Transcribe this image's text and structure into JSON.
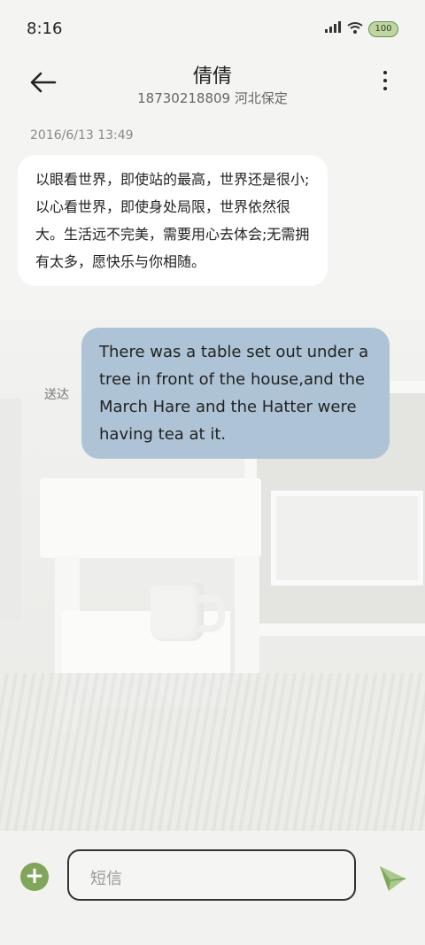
{
  "status_bar": {
    "time": "8:16",
    "signal_text": "000",
    "battery": "100"
  },
  "header": {
    "contact_name": "倩倩",
    "contact_detail": "18730218809 河北保定"
  },
  "conversation": {
    "date": "2016/6/13 13:49",
    "incoming_text": "以眼看世界，即使站的最高，世界还是很小;以心看世界，即使身处局限，世界依然很大。生活远不完美，需要用心去体会;无需拥有太多，愿快乐与你相随。",
    "outgoing_text": "There was a table set out under a tree in front of the house,and the March Hare and the Hatter were having tea at it.",
    "outgoing_status": "送达"
  },
  "composer": {
    "placeholder": "短信"
  },
  "icons": {
    "back": "arrow-left-icon",
    "menu": "more-vertical-icon",
    "add": "plus-circle-icon",
    "send": "paper-plane-icon",
    "wifi": "wifi-icon",
    "signal": "signal-icon",
    "battery": "battery-icon"
  },
  "colors": {
    "incoming_bubble": "#ffffff",
    "outgoing_bubble": "#aec4d6",
    "accent_green": "#7fa65a"
  }
}
